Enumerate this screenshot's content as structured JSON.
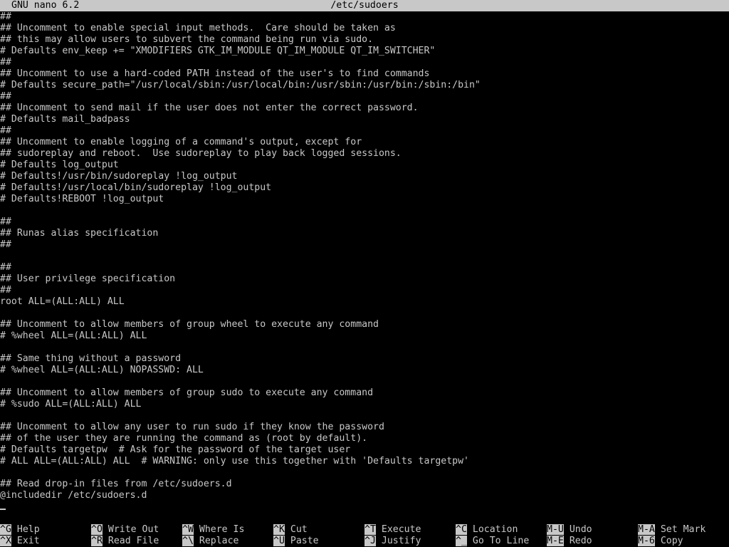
{
  "title_bar": {
    "app_version": "GNU nano 6.2",
    "file_path": "/etc/sudoers"
  },
  "editor": {
    "lines": [
      "##",
      "## Uncomment to enable special input methods.  Care should be taken as",
      "## this may allow users to subvert the command being run via sudo.",
      "# Defaults env_keep += \"XMODIFIERS GTK_IM_MODULE QT_IM_MODULE QT_IM_SWITCHER\"",
      "##",
      "## Uncomment to use a hard-coded PATH instead of the user's to find commands",
      "# Defaults secure_path=\"/usr/local/sbin:/usr/local/bin:/usr/sbin:/usr/bin:/sbin:/bin\"",
      "##",
      "## Uncomment to send mail if the user does not enter the correct password.",
      "# Defaults mail_badpass",
      "##",
      "## Uncomment to enable logging of a command's output, except for",
      "## sudoreplay and reboot.  Use sudoreplay to play back logged sessions.",
      "# Defaults log_output",
      "# Defaults!/usr/bin/sudoreplay !log_output",
      "# Defaults!/usr/local/bin/sudoreplay !log_output",
      "# Defaults!REBOOT !log_output",
      "",
      "##",
      "## Runas alias specification",
      "##",
      "",
      "##",
      "## User privilege specification",
      "##",
      "root ALL=(ALL:ALL) ALL",
      "",
      "## Uncomment to allow members of group wheel to execute any command",
      "# %wheel ALL=(ALL:ALL) ALL",
      "",
      "## Same thing without a password",
      "# %wheel ALL=(ALL:ALL) NOPASSWD: ALL",
      "",
      "## Uncomment to allow members of group sudo to execute any command",
      "# %sudo ALL=(ALL:ALL) ALL",
      "",
      "## Uncomment to allow any user to run sudo if they know the password",
      "## of the user they are running the command as (root by default).",
      "# Defaults targetpw  # Ask for the password of the target user",
      "# ALL ALL=(ALL:ALL) ALL  # WARNING: only use this together with 'Defaults targetpw'",
      "",
      "## Read drop-in files from /etc/sudoers.d",
      "@includedir /etc/sudoers.d",
      ""
    ]
  },
  "shortcuts_row1": [
    {
      "key": "^G",
      "label": "Help"
    },
    {
      "key": "^O",
      "label": "Write Out"
    },
    {
      "key": "^W",
      "label": "Where Is"
    },
    {
      "key": "^K",
      "label": "Cut"
    },
    {
      "key": "^T",
      "label": "Execute"
    },
    {
      "key": "^C",
      "label": "Location"
    },
    {
      "key": "M-U",
      "label": "Undo"
    },
    {
      "key": "M-A",
      "label": "Set Mark"
    }
  ],
  "shortcuts_row2": [
    {
      "key": "^X",
      "label": "Exit"
    },
    {
      "key": "^R",
      "label": "Read File"
    },
    {
      "key": "^\\",
      "label": "Replace"
    },
    {
      "key": "^U",
      "label": "Paste"
    },
    {
      "key": "^J",
      "label": "Justify"
    },
    {
      "key": "^_",
      "label": "Go To Line"
    },
    {
      "key": "M-E",
      "label": "Redo"
    },
    {
      "key": "M-6",
      "label": "Copy"
    }
  ],
  "colors": {
    "background": "#000000",
    "foreground": "#c8c8c8",
    "inverse_background": "#c8c8c8",
    "inverse_foreground": "#000000"
  }
}
